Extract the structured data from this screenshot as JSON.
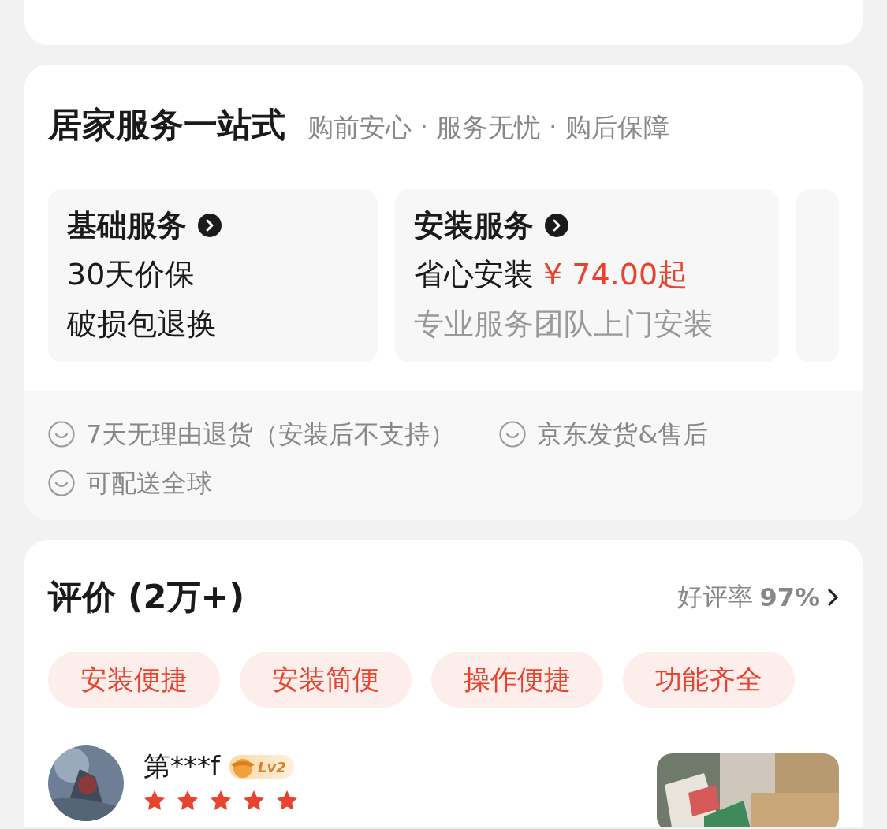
{
  "home_service": {
    "title": "居家服务一站式",
    "subtitle": "购前安心 · 服务无忧 · 购后保障",
    "services": [
      {
        "name": "基础服务",
        "lines": [
          {
            "kind": "plain",
            "text": "30天价保"
          },
          {
            "kind": "plain",
            "text": "破损包退换"
          }
        ]
      },
      {
        "name": "安装服务",
        "lines": [
          {
            "kind": "price",
            "text": "省心安装",
            "price": "¥ 74.00起"
          },
          {
            "kind": "muted",
            "text": "专业服务团队上门安装"
          }
        ]
      }
    ],
    "more_services": true,
    "guarantees": [
      "7天无理由退货（安装后不支持）",
      "京东发货&售后",
      "可配送全球"
    ]
  },
  "reviews": {
    "title": "评价 (2万+)",
    "rating_label": "好评率",
    "rating_value": "97%",
    "tags": [
      "安装便捷",
      "安装简便",
      "操作便捷",
      "功能齐全"
    ],
    "items": [
      {
        "user": "第***f",
        "level": "Lv2",
        "stars": 5
      }
    ]
  }
}
